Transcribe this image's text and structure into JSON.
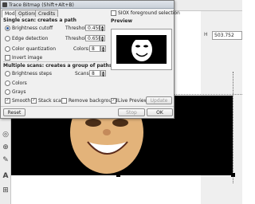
{
  "app": {
    "coord_label": "H",
    "coord_value": "503.752",
    "left_tools": [
      "◎",
      "⊕",
      "✎",
      "A",
      "⊞"
    ]
  },
  "dialog": {
    "title": "Trace Bitmap (Shift+Alt+B)",
    "tabs": [
      "Mode",
      "Options",
      "Credits"
    ],
    "sioe_label": "SIOX foreground selection",
    "preview_label": "Preview",
    "single_scan_heading": "Single scan: creates a path",
    "brightness_cutoff": "Brightness cutoff",
    "threshold_label": "Threshold:",
    "threshold_value_1": "0.450",
    "edge_detection": "Edge detection",
    "threshold_value_2": "0.650",
    "color_quantization": "Color quantization",
    "colors_label": "Colors:",
    "colors_value": "8",
    "invert_image": "Invert image",
    "multiple_scans_heading": "Multiple scans: creates a group of paths",
    "brightness_steps": "Brightness steps",
    "scans_label": "Scans:",
    "scans_value": "8",
    "colors_option": "Colors",
    "grays_option": "Grays",
    "smooth": "Smooth",
    "stack_scans": "Stack scans",
    "remove_background": "Remove background",
    "live_preview": "Live Preview",
    "update_button": "Update",
    "reset_button": "Reset",
    "stop_button": "Stop",
    "ok_button": "OK"
  }
}
